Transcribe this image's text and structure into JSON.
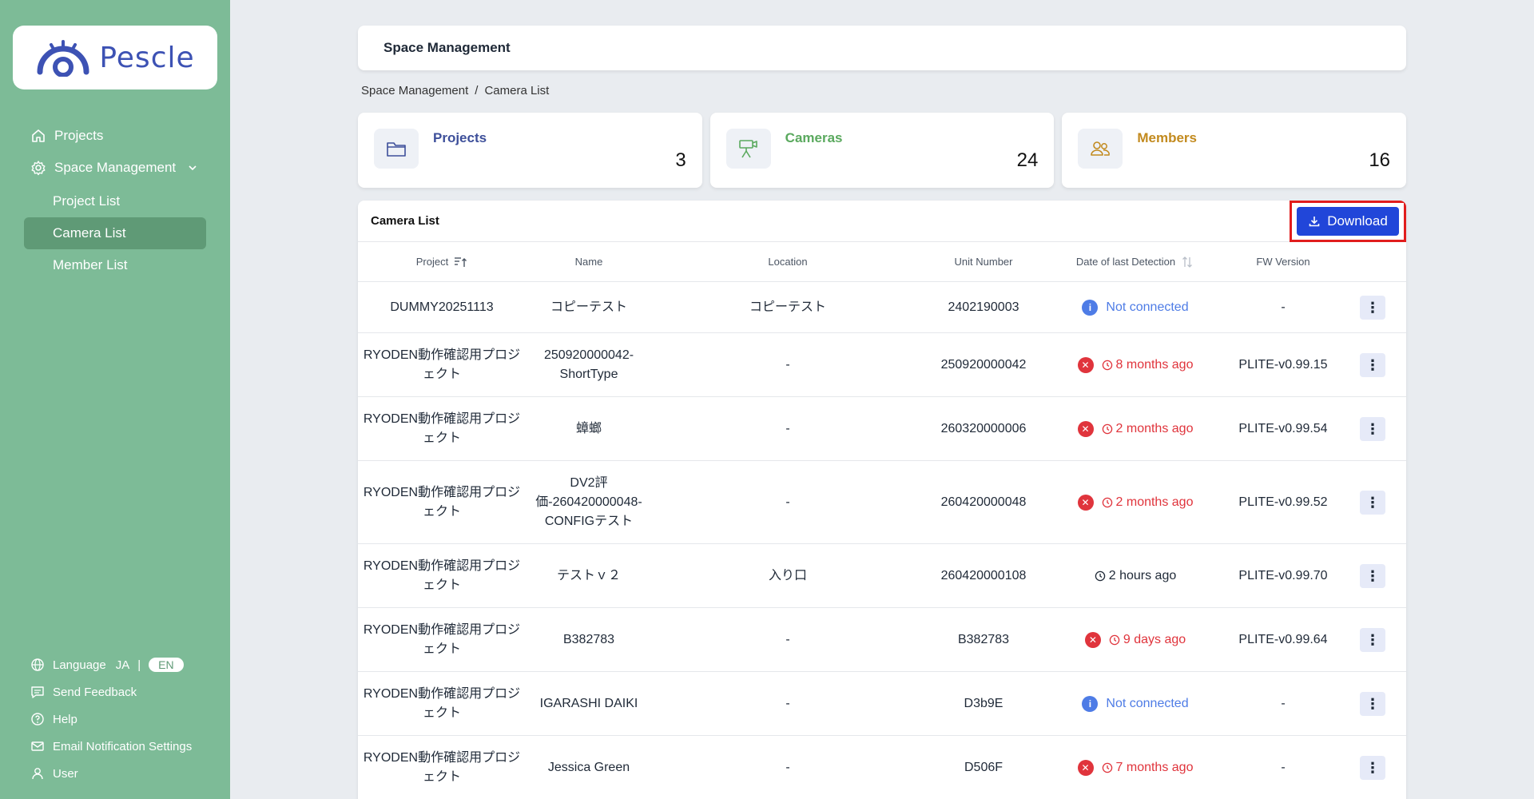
{
  "brand": {
    "name": "Pescle",
    "color": "#3d52b4"
  },
  "sidebar": {
    "items": [
      {
        "label": "Projects",
        "icon": "home-icon"
      },
      {
        "label": "Space Management",
        "icon": "gear-icon"
      }
    ],
    "sub_items": [
      {
        "label": "Project List"
      },
      {
        "label": "Camera List"
      },
      {
        "label": "Member List"
      }
    ],
    "bottom": {
      "language_label": "Language",
      "lang_ja": "JA",
      "lang_sep": "|",
      "lang_en": "EN",
      "send_feedback": "Send Feedback",
      "help": "Help",
      "email_settings": "Email Notification Settings",
      "user": "User"
    }
  },
  "header": {
    "title": "Space Management"
  },
  "breadcrumb": {
    "parent": "Space Management",
    "sep": "/",
    "current": "Camera List"
  },
  "stats": [
    {
      "label": "Projects",
      "value": "3",
      "color": "#3d4f9a"
    },
    {
      "label": "Cameras",
      "value": "24",
      "color": "#5aa95e"
    },
    {
      "label": "Members",
      "value": "16",
      "color": "#c28a1e"
    }
  ],
  "table": {
    "title": "Camera List",
    "download_label": "Download",
    "columns": {
      "project": "Project",
      "name": "Name",
      "location": "Location",
      "unit": "Unit Number",
      "date": "Date of last Detection",
      "fw": "FW Version"
    },
    "rows": [
      {
        "project": "DUMMY20251113",
        "name": "コピーテスト",
        "location": "コピーテスト",
        "unit": "2402190003",
        "status": "info",
        "date": "Not connected",
        "fw": "-"
      },
      {
        "project": "RYODEN動作確認用プロジェクト",
        "name": "250920000042-ShortType",
        "location": "-",
        "unit": "250920000042",
        "status": "error",
        "date": "8 months ago",
        "fw": "PLITE-v0.99.15"
      },
      {
        "project": "RYODEN動作確認用プロジェクト",
        "name": "蟑螂",
        "location": "-",
        "unit": "260320000006",
        "status": "error",
        "date": "2 months ago",
        "fw": "PLITE-v0.99.54"
      },
      {
        "project": "RYODEN動作確認用プロジェクト",
        "name": "DV2評価-260420000048-CONFIGテスト",
        "location": "-",
        "unit": "260420000048",
        "status": "error",
        "date": "2 months ago",
        "fw": "PLITE-v0.99.52"
      },
      {
        "project": "RYODEN動作確認用プロジェクト",
        "name": "テストｖ２",
        "location": "入り口",
        "unit": "260420000108",
        "status": "ok",
        "date": "2 hours ago",
        "fw": "PLITE-v0.99.70"
      },
      {
        "project": "RYODEN動作確認用プロジェクト",
        "name": "B382783",
        "location": "-",
        "unit": "B382783",
        "status": "error",
        "date": "9 days ago",
        "fw": "PLITE-v0.99.64"
      },
      {
        "project": "RYODEN動作確認用プロジェクト",
        "name": "IGARASHI DAIKI",
        "location": "-",
        "unit": "D3b9E",
        "status": "info",
        "date": "Not connected",
        "fw": "-"
      },
      {
        "project": "RYODEN動作確認用プロジェクト",
        "name": "Jessica Green",
        "location": "-",
        "unit": "D506F",
        "status": "error",
        "date": "7 months ago",
        "fw": "-"
      }
    ]
  }
}
